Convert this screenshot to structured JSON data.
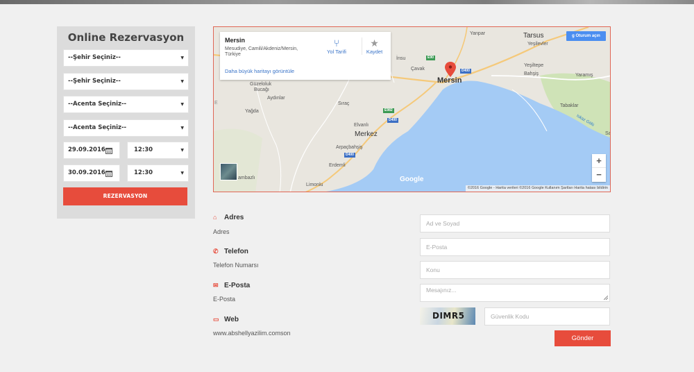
{
  "reservation": {
    "title": "Online Rezervasyon",
    "city_from": "--Şehir Seçiniz--",
    "city_to": "--Şehir Seçiniz--",
    "agency_from": "--Acenta Seçiniz--",
    "agency_to": "--Acenta Seçiniz--",
    "date_1": "29.09.2016",
    "time_1": "12:30",
    "date_2": "30.09.2016",
    "time_2": "12:30",
    "submit_label": "REZERVASYON"
  },
  "map": {
    "place_title": "Mersin",
    "place_address": "Mesudiye, Camili/Akdeniz/Mersin, Türkiye",
    "larger_map_link": "Daha büyük haritayı görüntüle",
    "directions_label": "Yol Tarifi",
    "save_label": "Kaydet",
    "signin_label": "Oturum açın",
    "labels": {
      "yanpar": "Yanpar",
      "tarsus": "Tarsus",
      "yesilevler": "Yeşilevler",
      "insu": "İnsu",
      "cavak": "Çavak",
      "mersin": "Mersin",
      "yesiltepe": "Yeşiltepe",
      "bahsis": "Bahşiş",
      "yaramis": "Yaramış",
      "guzeloluk": "Güzeloluk",
      "bucagi": "Bucağı",
      "aydinlar": "Aydınlar",
      "sirac": "Sıraç",
      "yagda": "Yağda",
      "elvanli": "Elvanlı",
      "merkez": "Merkez",
      "arpacbahsis": "Arpaçbahşiş",
      "erdemli": "Erdemli",
      "limonlu": "Limonlu",
      "tabaklar": "Tabaklar",
      "ambazli": "ambazlı",
      "sa": "Sa",
      "bay": "Iskaz Gölü",
      "kuz": "E"
    },
    "road_badges": {
      "e90": "E90",
      "d400a": "D400",
      "e982": "E982",
      "d400b": "D400",
      "d400c": "D400"
    },
    "google_logo": "Google",
    "attribution": "©2016 Google - Harita verileri ©2016 Google   Kullanım Şartları   Harita hatası bildirin",
    "zoom_in": "+",
    "zoom_out": "−"
  },
  "contact": {
    "address_label": "Adres",
    "address_value": "Adres",
    "phone_label": "Telefon",
    "phone_value": "Telefon Numarsı",
    "email_label": "E-Posta",
    "email_value": "E-Posta",
    "web_label": "Web",
    "web_value": "www.abshellyazilim.comson"
  },
  "form": {
    "name_placeholder": "Ad ve Soyad",
    "email_placeholder": "E-Posta",
    "subject_placeholder": "Konu",
    "message_placeholder": "Mesajınız...",
    "captcha_text": "DIMR5",
    "security_placeholder": "Güvenlik Kodu",
    "submit_label": "Gönder"
  },
  "colors": {
    "accent": "#e74c3c",
    "sea": "#a4cbf5",
    "land": "#e9e6df"
  }
}
